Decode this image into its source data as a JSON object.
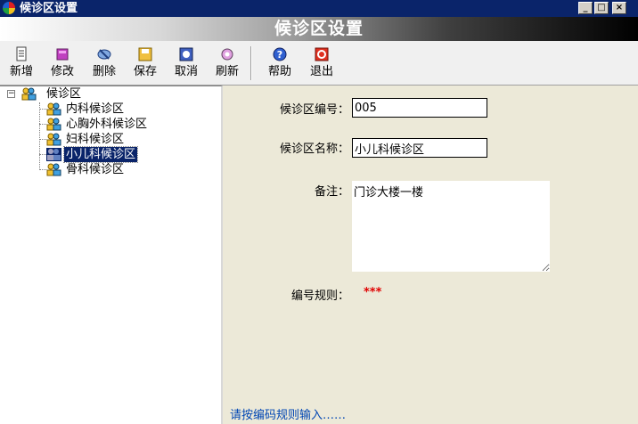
{
  "window": {
    "title": "候诊区设置",
    "controls": {
      "minimize": "_",
      "maximize": "□",
      "close": "×"
    }
  },
  "banner": {
    "title": "候诊区设置"
  },
  "toolbar": {
    "buttons": [
      {
        "label": "新增",
        "icon": "new-doc-icon"
      },
      {
        "label": "修改",
        "icon": "edit-book-icon"
      },
      {
        "label": "删除",
        "icon": "delete-icon"
      },
      {
        "label": "保存",
        "icon": "save-icon"
      },
      {
        "label": "取消",
        "icon": "cancel-icon"
      },
      {
        "label": "刷新",
        "icon": "refresh-icon"
      },
      {
        "label": "帮助",
        "icon": "help-icon"
      },
      {
        "label": "退出",
        "icon": "exit-icon"
      }
    ]
  },
  "tree": {
    "root": {
      "label": "候诊区",
      "expander": "−"
    },
    "items": [
      {
        "label": "内科候诊区"
      },
      {
        "label": "心胸外科候诊区"
      },
      {
        "label": "妇科候诊区"
      },
      {
        "label": "小儿科候诊区",
        "selected": true
      },
      {
        "label": "骨科候诊区"
      }
    ]
  },
  "form": {
    "code_label": "候诊区编号：",
    "code_value": "005",
    "name_label": "候诊区名称：",
    "name_value": "小儿科候诊区",
    "remark_label": "备注：",
    "remark_value": "门诊大楼一楼",
    "rule_label": "编号规则：",
    "rule_value": "***"
  },
  "status": {
    "hint": "请按编码规则输入……"
  },
  "colors": {
    "title_bar": "#0a246a",
    "selection": "#0a246a",
    "rule_red": "#e00000",
    "hint_blue": "#0046b4"
  }
}
